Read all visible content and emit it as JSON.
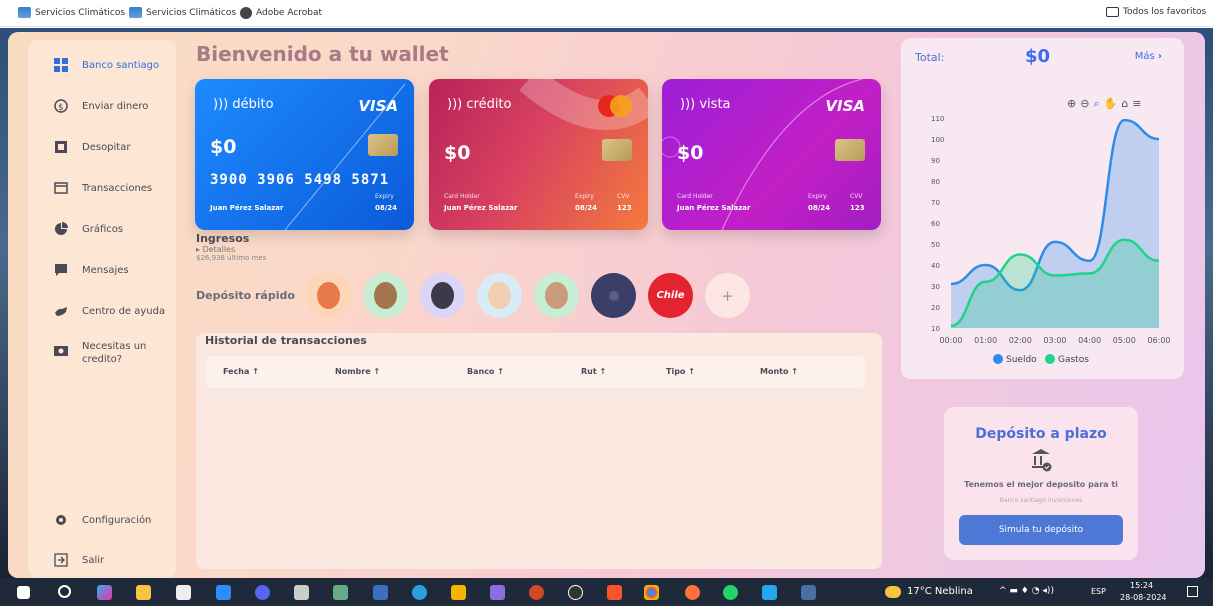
{
  "bookmarks": {
    "items": [
      {
        "label": "Servicios Climáticos"
      },
      {
        "label": "Servicios Climáticos"
      },
      {
        "label": "Adobe Acrobat"
      }
    ],
    "all_favorites": "Todos los favoritos"
  },
  "sidebar": {
    "items": [
      {
        "label": "Banco santiago",
        "icon": "dashboard-icon",
        "active": true
      },
      {
        "label": "Enviar dinero",
        "icon": "send-money-icon"
      },
      {
        "label": "Desopitar",
        "icon": "deposit-icon"
      },
      {
        "label": "Transacciones",
        "icon": "card-icon"
      },
      {
        "label": "Gráficos",
        "icon": "pie-chart-icon"
      },
      {
        "label": "Mensajes",
        "icon": "message-icon"
      },
      {
        "label": "Centro de ayuda",
        "icon": "help-icon"
      },
      {
        "label": "Necesitas un credito?",
        "icon": "cash-icon"
      }
    ],
    "bottom": [
      {
        "label": "Configuración",
        "icon": "gear-icon"
      },
      {
        "label": "Salir",
        "icon": "logout-icon"
      }
    ]
  },
  "main": {
    "welcome": "Bienvenido a tu wallet",
    "cards": [
      {
        "type": "débito",
        "brand": "VISA",
        "balance": "$0",
        "number": "3900 3906 5498 5871",
        "expiry_label": "Expiry",
        "expiry": "08/24",
        "holder": "Juan Pérez Salazar"
      },
      {
        "type": "crédito",
        "brand": "mastercard",
        "balance": "$0",
        "holder_label": "Card Holder",
        "holder": "Juan Pérez Salazar",
        "expiry_label": "Expiry",
        "expiry": "08/24",
        "cvv_label": "CVV",
        "cvv": "123"
      },
      {
        "type": "vista",
        "brand": "VISA",
        "balance": "$0",
        "holder_label": "Card Holder",
        "holder": "Juan Pérez Salazar",
        "expiry_label": "Expiry",
        "expiry": "08/24",
        "cvv_label": "CVV",
        "cvv": "123"
      }
    ],
    "ingresos": {
      "title": "Ingresos",
      "details": "Detalles",
      "amount": "$26,938 último mes"
    },
    "quick_deposit": {
      "label": "Depósito rápido",
      "chile_label": "Chile",
      "add_label": "+"
    },
    "history": {
      "title": "Historial de transacciones",
      "columns": [
        "Fecha ↑",
        "Nombre ↑",
        "Banco ↑",
        "Rut ↑",
        "Tipo ↑",
        "Monto ↑"
      ]
    }
  },
  "right": {
    "total_label": "Total:",
    "total_value": "$0",
    "more": "Más"
  },
  "chart_data": {
    "type": "area",
    "x": [
      "00:00",
      "01:00",
      "02:00",
      "03:00",
      "04:00",
      "05:00",
      "06:00"
    ],
    "ylim": [
      10,
      110
    ],
    "yticks": [
      10,
      20,
      30,
      40,
      50,
      60,
      70,
      80,
      90,
      100,
      110
    ],
    "series": [
      {
        "name": "Sueldo",
        "color": "#2f8be8",
        "values": [
          31,
          40,
          28,
          51,
          42,
          109,
          100
        ]
      },
      {
        "name": "Gastos",
        "color": "#1fd38a",
        "values": [
          11,
          32,
          45,
          35,
          36,
          52,
          42
        ]
      }
    ],
    "legend": "bottom",
    "grid": false
  },
  "deposit_box": {
    "title": "Depósito a plazo",
    "subtitle": "Tenemos el mejor deposito para ti",
    "caption": "Banco santiago inversiones",
    "button": "Simula tu depósito"
  },
  "taskbar": {
    "weather": "17°C Neblina",
    "lang": "ESP",
    "time": "15:24",
    "date": "28-08-2024"
  }
}
